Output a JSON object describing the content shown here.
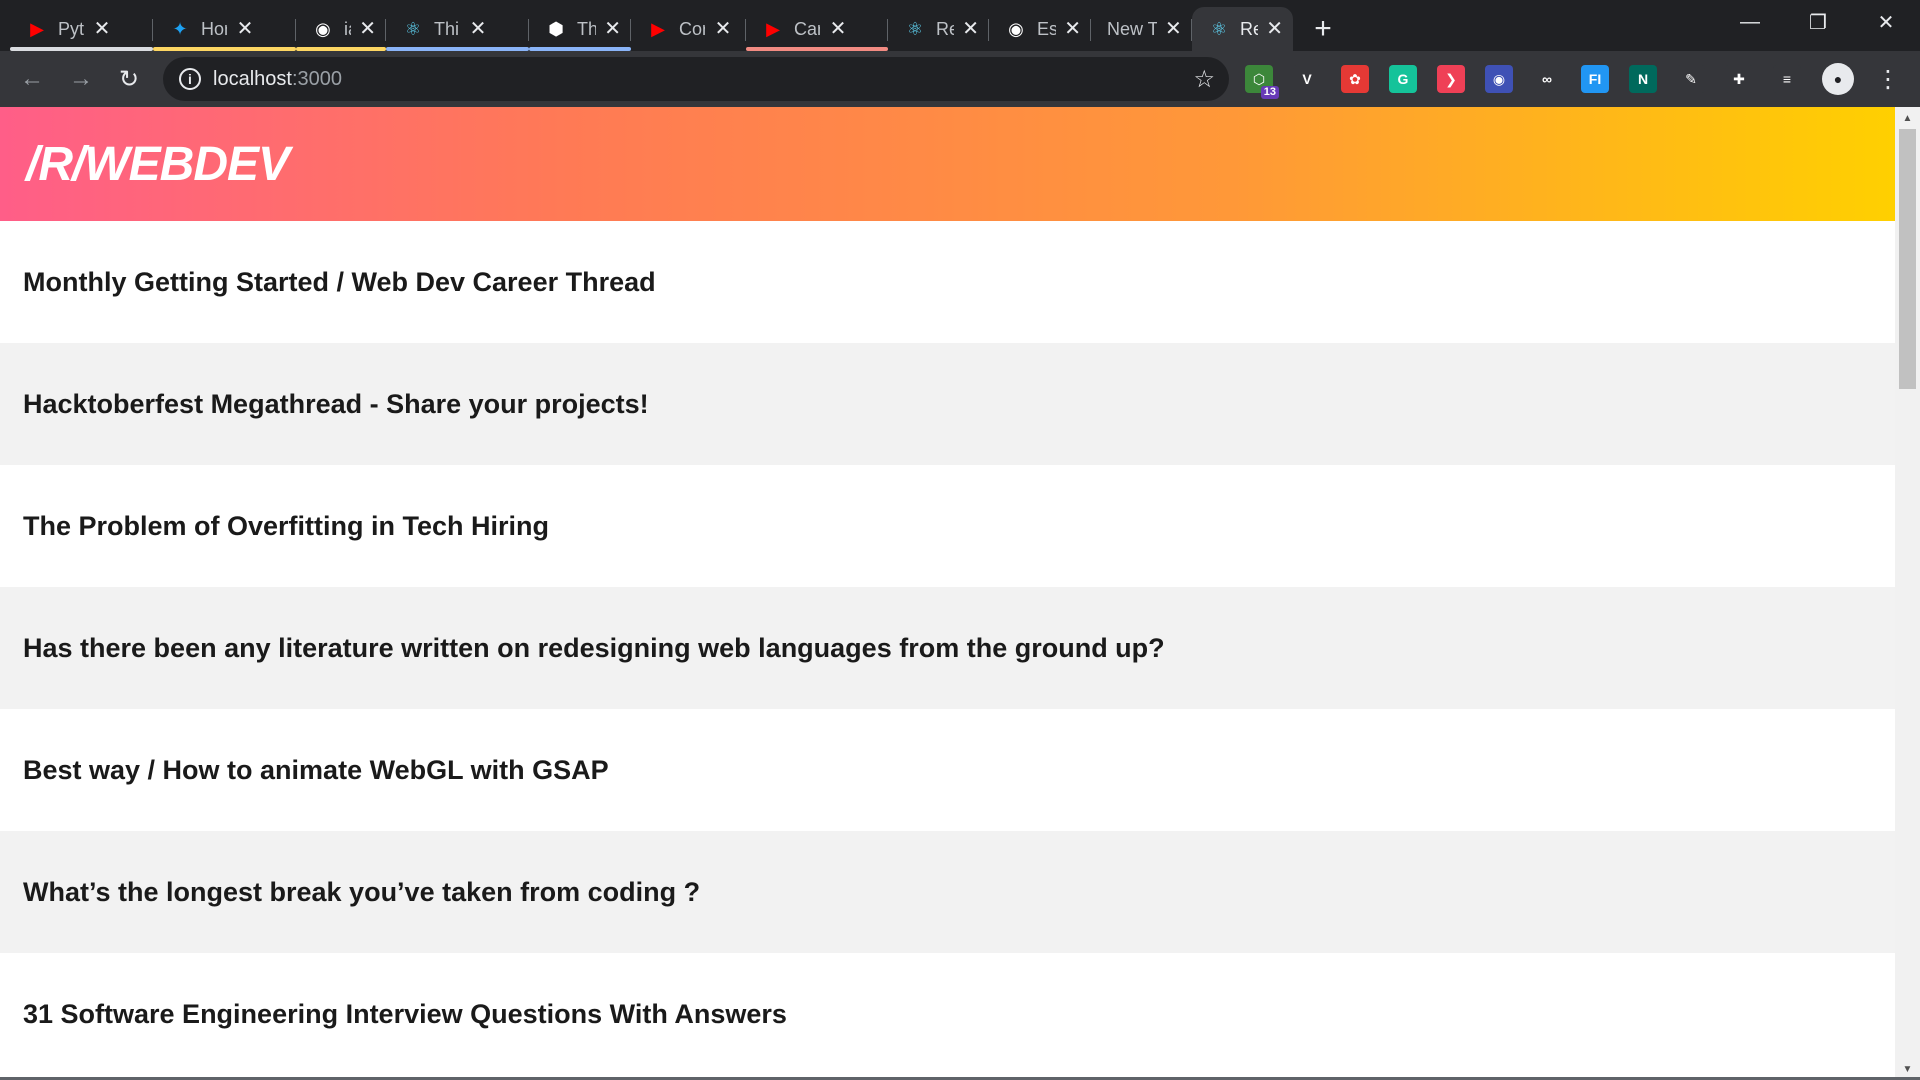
{
  "browser": {
    "tabs": [
      {
        "title": "Pytl",
        "favicon": "youtube-icon",
        "color": "#ff0000",
        "group_color": "#dadce0"
      },
      {
        "title": "Hor",
        "favicon": "twitter-icon",
        "color": "#1da1f2",
        "group_color": "#fdd663"
      },
      {
        "title": "iam",
        "favicon": "github-icon",
        "color": "#ffffff",
        "group_color": "#fdd663"
      },
      {
        "title": "Thir",
        "favicon": "react-icon",
        "color": "#61dafb",
        "group_color": "#8ab4f8"
      },
      {
        "title": "Thir",
        "favicon": "codesandbox-icon",
        "color": "#ffffff",
        "group_color": "#8ab4f8"
      },
      {
        "title": "Cor",
        "favicon": "youtube-icon",
        "color": "#ff0000",
        "group_color": ""
      },
      {
        "title": "Car",
        "favicon": "youtube-icon",
        "color": "#ff0000",
        "group_color": "#f28b82"
      },
      {
        "title": "Rea",
        "favicon": "react-icon",
        "color": "#61dafb",
        "group_color": ""
      },
      {
        "title": "Esp",
        "favicon": "github-icon",
        "color": "#ffffff",
        "group_color": ""
      },
      {
        "title": "New Tal",
        "favicon": "",
        "color": "",
        "group_color": ""
      },
      {
        "title": "Rea",
        "favicon": "react-icon",
        "color": "#61dafb",
        "group_color": "",
        "active": true
      }
    ],
    "group_dots": [
      "#dadce0",
      "#fdd663",
      "#8ab4f8",
      "#f28b82"
    ],
    "url_host": "localhost",
    "url_port": ":3000",
    "extensions": [
      {
        "name": "nodejs-ext-icon",
        "label": "⬡",
        "bg": "#3c873a",
        "badge": "13"
      },
      {
        "name": "vue-devtools-icon",
        "label": "V",
        "bg": "#35363a"
      },
      {
        "name": "ext-red-icon",
        "label": "✿",
        "bg": "#e53935"
      },
      {
        "name": "grammarly-icon",
        "label": "G",
        "bg": "#15c39a"
      },
      {
        "name": "pocket-icon",
        "label": "❯",
        "bg": "#ef4056"
      },
      {
        "name": "screen-capture-icon",
        "label": "◉",
        "bg": "#3f51b5"
      },
      {
        "name": "ext-glasses-icon",
        "label": "∞",
        "bg": "#35363a"
      },
      {
        "name": "fi-ext-icon",
        "label": "FI",
        "bg": "#2196f3"
      },
      {
        "name": "n-ext-icon",
        "label": "N",
        "bg": "#00695c"
      },
      {
        "name": "pen-ext-icon",
        "label": "✎",
        "bg": "#35363a"
      },
      {
        "name": "puzzle-icon",
        "label": "✚",
        "bg": "#35363a"
      },
      {
        "name": "media-control-icon",
        "label": "≡",
        "bg": "#35363a"
      }
    ]
  },
  "page": {
    "title": "/R/WEBDEV",
    "posts": [
      "Monthly Getting Started / Web Dev Career Thread",
      "Hacktoberfest Megathread - Share your projects!",
      "The Problem of Overfitting in Tech Hiring",
      "Has there been any literature written on redesigning web languages from the ground up?",
      "Best way / How to animate WebGL with GSAP",
      "What’s the longest break you’ve taken from coding ?",
      "31 Software Engineering Interview Questions With Answers"
    ]
  }
}
